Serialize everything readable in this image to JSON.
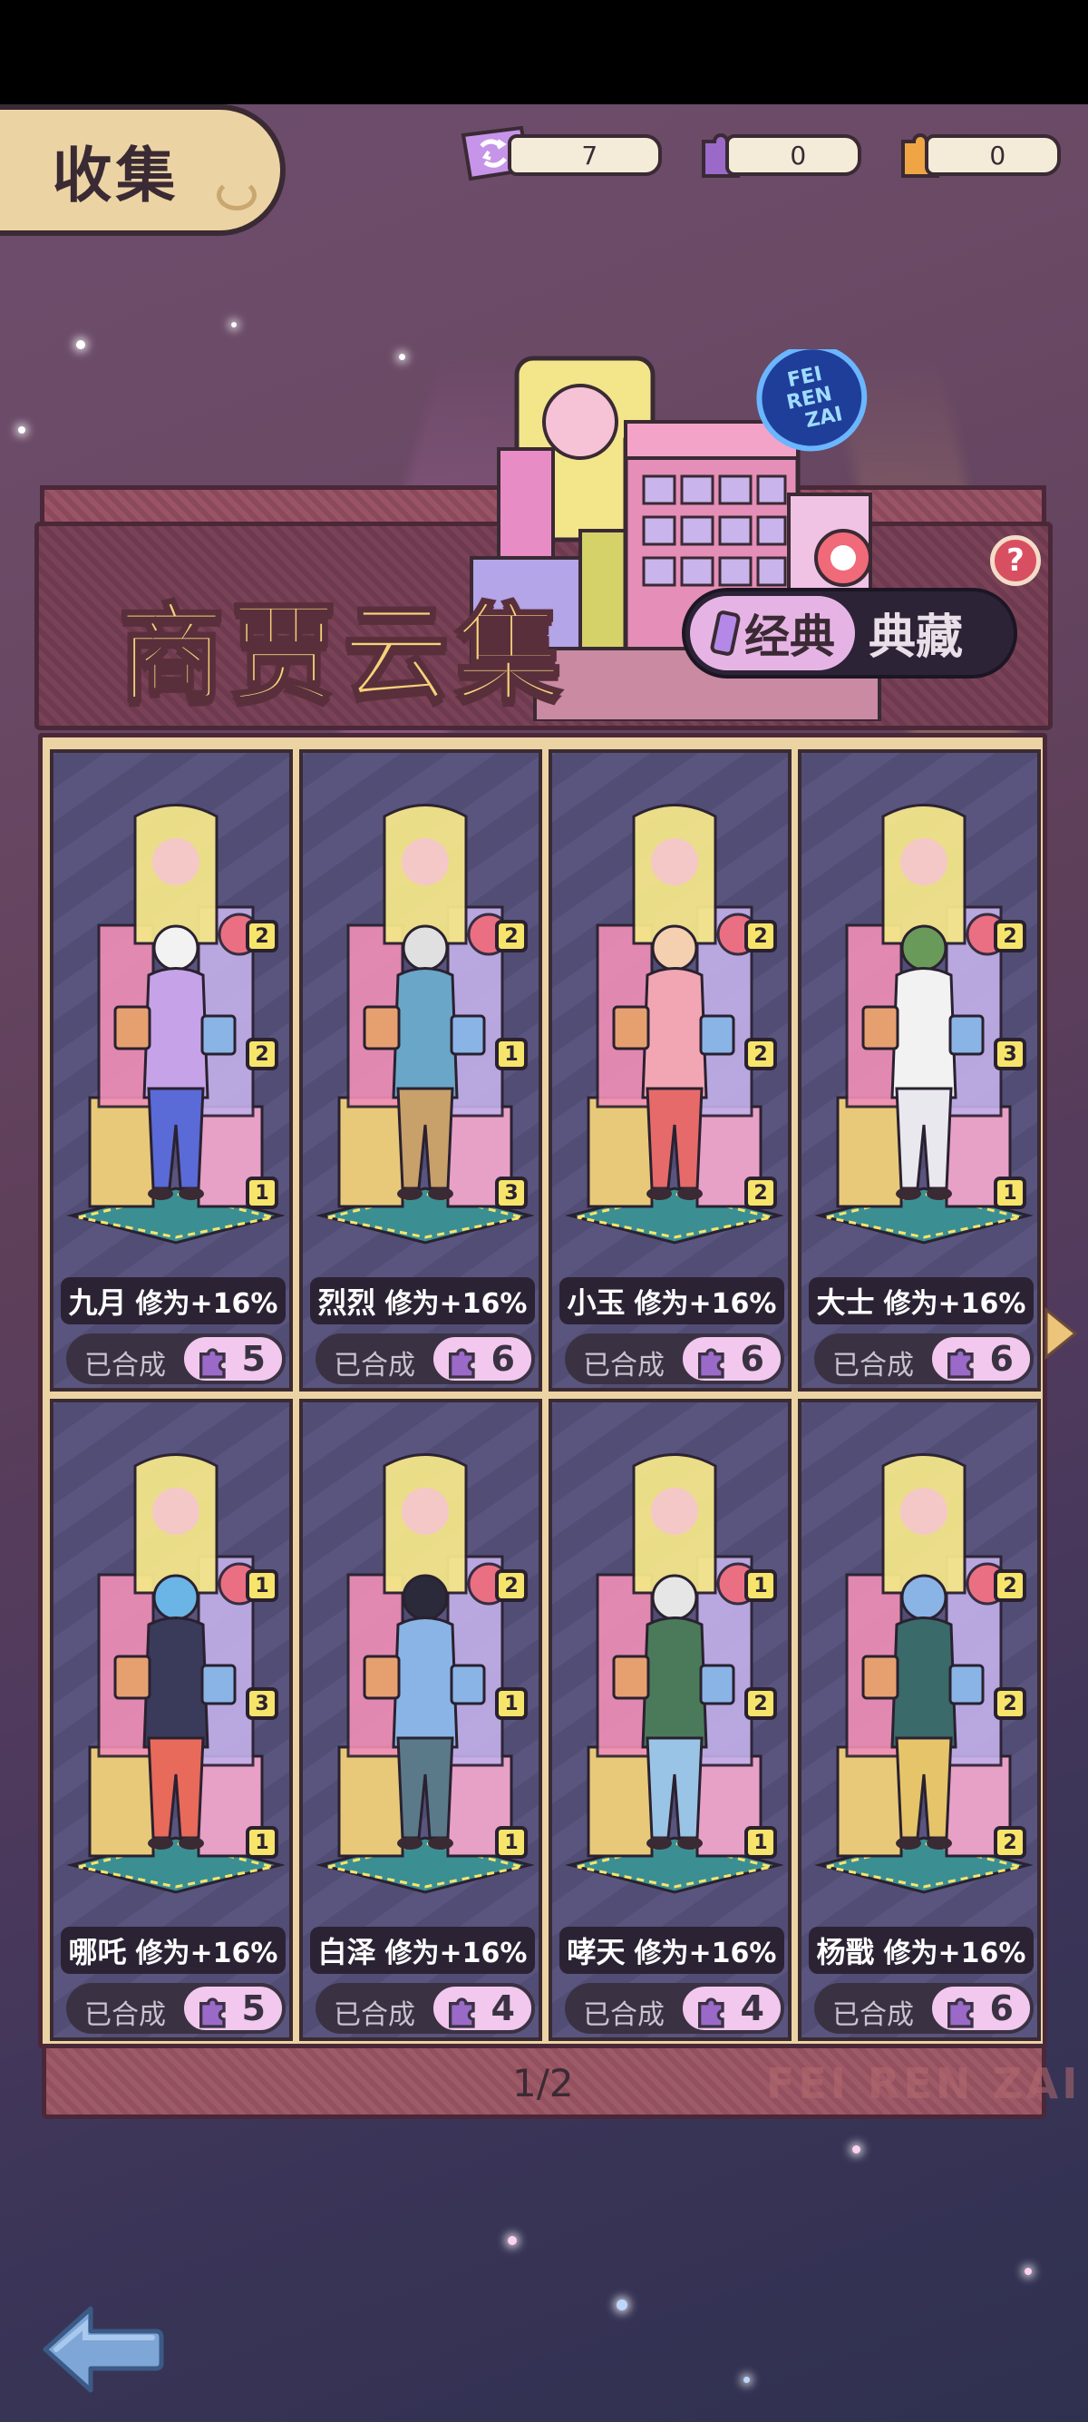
{
  "header": {
    "title": "收集",
    "resources": [
      {
        "icon": "ticket-icon",
        "value": "7",
        "color": "#a86ad6"
      },
      {
        "icon": "purple-puzzle-icon",
        "value": "0",
        "color": "#9b6ac9"
      },
      {
        "icon": "orange-puzzle-icon",
        "value": "0",
        "color": "#f0a545"
      }
    ]
  },
  "banner": {
    "title": "商贾云集",
    "logo_text": [
      "FEI",
      "REN",
      "ZAI"
    ],
    "tabs": {
      "classic": "经典",
      "collection": "典藏"
    },
    "help": "?"
  },
  "characters": [
    {
      "name": "九月",
      "bonus": "修为+16%",
      "synth_label": "已合成",
      "synth_count": "5",
      "badges": [
        "2",
        "2",
        "1"
      ]
    },
    {
      "name": "烈烈",
      "bonus": "修为+16%",
      "synth_label": "已合成",
      "synth_count": "6",
      "badges": [
        "2",
        "1",
        "3"
      ]
    },
    {
      "name": "小玉",
      "bonus": "修为+16%",
      "synth_label": "已合成",
      "synth_count": "6",
      "badges": [
        "2",
        "2",
        "2"
      ]
    },
    {
      "name": "大士",
      "bonus": "修为+16%",
      "synth_label": "已合成",
      "synth_count": "6",
      "badges": [
        "2",
        "3",
        "1"
      ]
    },
    {
      "name": "哪吒",
      "bonus": "修为+16%",
      "synth_label": "已合成",
      "synth_count": "5",
      "badges": [
        "1",
        "3",
        "1"
      ]
    },
    {
      "name": "白泽",
      "bonus": "修为+16%",
      "synth_label": "已合成",
      "synth_count": "4",
      "badges": [
        "2",
        "1",
        "1"
      ]
    },
    {
      "name": "哮天",
      "bonus": "修为+16%",
      "synth_label": "已合成",
      "synth_count": "4",
      "badges": [
        "1",
        "2",
        "1"
      ]
    },
    {
      "name": "杨戬",
      "bonus": "修为+16%",
      "synth_label": "已合成",
      "synth_count": "6",
      "badges": [
        "2",
        "2",
        "2"
      ]
    }
  ],
  "pagination": {
    "text": "1/2"
  },
  "footer": {
    "watermark": "FEI REN ZAI"
  },
  "colors": {
    "accent_pink": "#f2c8ef",
    "gold_title": "#f6d27a",
    "badge_yellow": "#f7e56b",
    "card_bg": "#55507a"
  }
}
